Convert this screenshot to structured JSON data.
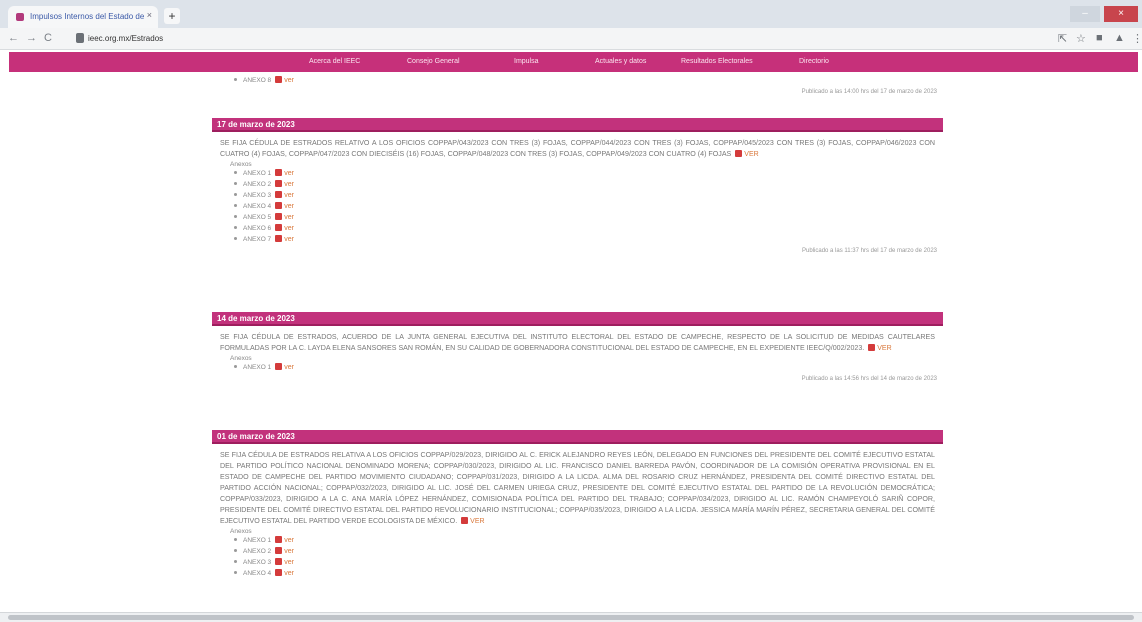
{
  "browser": {
    "tab_title": "Impulsos Internos del Estado de",
    "tab_close": "×",
    "new_tab": "+",
    "url": "ieec.org.mx/Estrados",
    "back": "←",
    "forward": "→",
    "reload": "C",
    "win_min": "–",
    "win_close": "×",
    "share": "⇱",
    "star": "☆",
    "ext": "■",
    "profile": "▲",
    "menu": "⋮"
  },
  "site_nav": {
    "items": [
      "Acerca del IEEC",
      "Consejo General",
      "Impulsa",
      "Actuales y datos",
      "Resultados Electorales",
      "Directorio"
    ]
  },
  "top_residual": {
    "anexo": "ANEXO 8",
    "ver": "ver",
    "published": "Publicado a las 14:00 hrs del 17 de marzo de 2023"
  },
  "blocks": [
    {
      "date": "17 de marzo de 2023",
      "body": "SE FIJA CÉDULA DE ESTRADOS RELATIVO A LOS OFICIOS COPPAP/043/2023 CON TRES (3) FOJAS, COPPAP/044/2023 CON TRES (3) FOJAS, COPPAP/045/2023 CON TRES (3) FOJAS, COPPAP/046/2023 CON CUATRO (4) FOJAS, COPPAP/047/2023 CON DIECISÉIS (16) FOJAS, COPPAP/048/2023 CON TRES (3) FOJAS, COPPAP/049/2023 CON CUATRO (4) FOJAS",
      "ver": "ver",
      "anexos_label": "Anexos",
      "anexos": [
        "ANEXO 1",
        "ANEXO 2",
        "ANEXO 3",
        "ANEXO 4",
        "ANEXO 5",
        "ANEXO 6",
        "ANEXO 7"
      ],
      "published": "Publicado a las 11:37 hrs del 17 de marzo de 2023"
    },
    {
      "date": "14 de marzo de 2023",
      "body": "SE FIJA CÉDULA DE ESTRADOS, ACUERDO DE LA JUNTA GENERAL EJECUTIVA DEL INSTITUTO ELECTORAL DEL ESTADO DE CAMPECHE, RESPECTO DE LA SOLICITUD DE MEDIDAS CAUTELARES FORMULADAS POR LA C. LAYDA ELENA SANSORES SAN ROMÁN, EN SU CALIDAD DE GOBERNADORA CONSTITUCIONAL DEL ESTADO DE CAMPECHE, EN EL EXPEDIENTE IEEC/Q/002/2023.",
      "ver": "ver",
      "anexos_label": "Anexos",
      "anexos": [
        "ANEXO 1"
      ],
      "published": "Publicado a las 14:56 hrs del 14 de marzo de 2023"
    },
    {
      "date": "01 de marzo de 2023",
      "body": "SE FIJA CÉDULA DE ESTRADOS RELATIVA A LOS OFICIOS COPPAP/029/2023, DIRIGIDO AL C. ERICK ALEJANDRO REYES LEÓN, DELEGADO EN FUNCIONES DEL PRESIDENTE DEL COMITÉ EJECUTIVO ESTATAL DEL PARTIDO POLÍTICO NACIONAL DENOMINADO MORENA; COPPAP/030/2023, DIRIGIDO AL LIC. FRANCISCO DANIEL BARREDA PAVÓN, COORDINADOR DE LA COMISIÓN OPERATIVA PROVISIONAL EN EL ESTADO DE CAMPECHE DEL PARTIDO MOVIMIENTO CIUDADANO; COPPAP/031/2023, DIRIGIDO A LA LICDA. ALMA DEL ROSARIO CRUZ HERNÁNDEZ, PRESIDENTA DEL COMITÉ DIRECTIVO ESTATAL DEL PARTIDO ACCIÓN NACIONAL; COPPAP/032/2023, DIRIGIDO AL LIC. JOSÉ DEL CARMEN URIEGA CRUZ, PRESIDENTE DEL COMITÉ EJECUTIVO ESTATAL DEL PARTIDO DE LA REVOLUCIÓN DEMOCRÁTICA; COPPAP/033/2023, DIRIGIDO A LA C. ANA MARÍA LÓPEZ HERNÁNDEZ, COMISIONADA POLÍTICA DEL PARTIDO DEL TRABAJO; COPPAP/034/2023, DIRIGIDO AL LIC. RAMÓN CHAMPEYOLÓ SARIÑ COPOR, PRESIDENTE DEL COMITÉ DIRECTIVO ESTATAL DEL PARTIDO REVOLUCIONARIO INSTITUCIONAL; COPPAP/035/2023, DIRIGIDO A LA LICDA. JESSICA MARÍA MARÍN PÉREZ, SECRETARIA GENERAL DEL COMITÉ EJECUTIVO ESTATAL DEL PARTIDO VERDE ECOLOGISTA DE MÉXICO.",
      "ver": "ver",
      "anexos_label": "Anexos",
      "anexos": [
        "ANEXO 1",
        "ANEXO 2",
        "ANEXO 3",
        "ANEXO 4"
      ],
      "published": ""
    }
  ],
  "colors": {
    "brand": "#c6307a",
    "header_band": "#c2327c"
  }
}
